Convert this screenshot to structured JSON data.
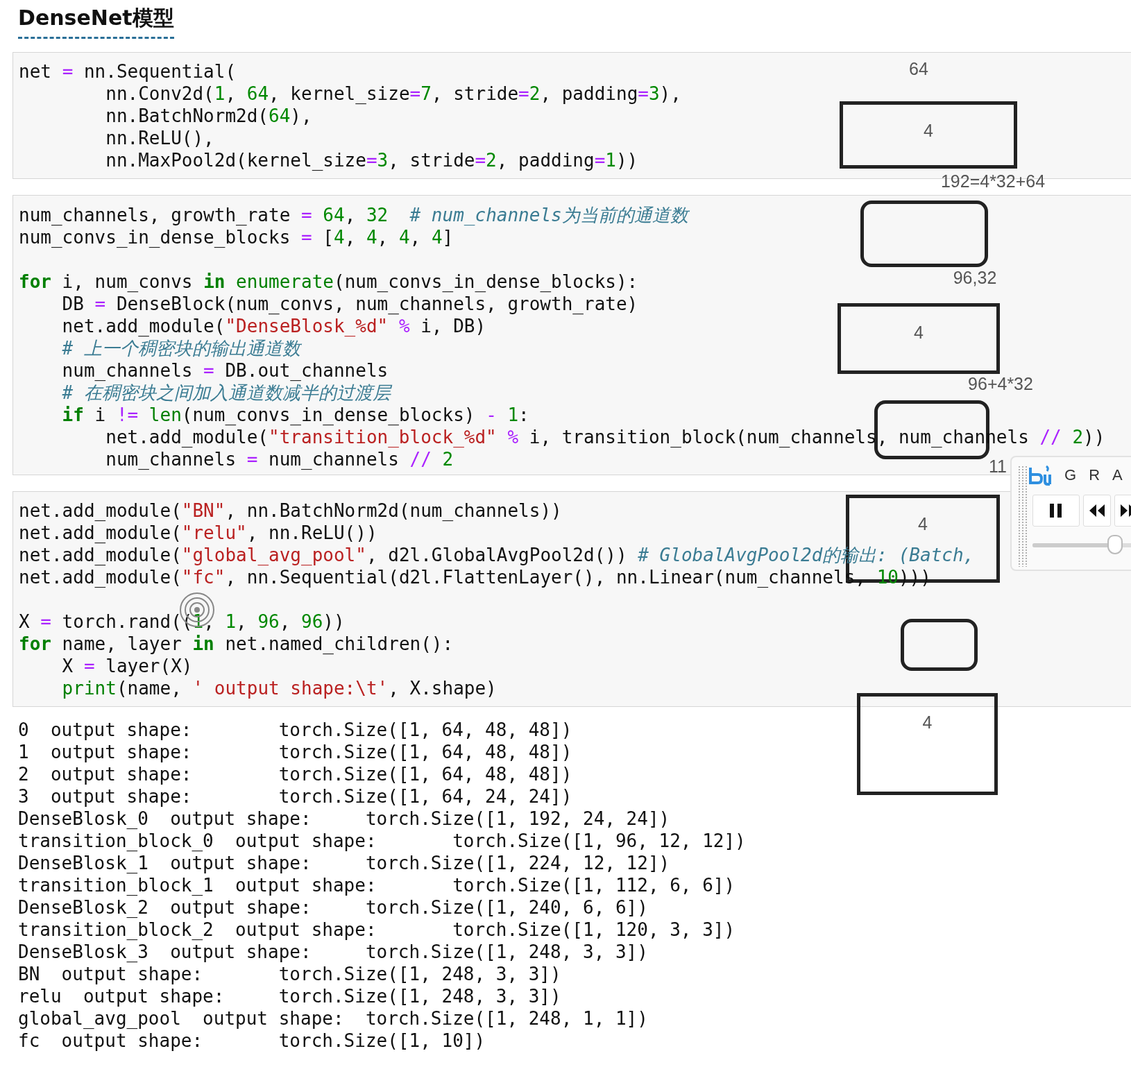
{
  "title": "DenseNet模型",
  "cells": [
    {
      "groups": [
        [
          [
            {
              "kind": "plain",
              "text": "net "
            },
            {
              "kind": "op",
              "text": "="
            },
            {
              "kind": "plain",
              "text": " nn.Sequential("
            }
          ],
          [
            {
              "kind": "plain",
              "text": "        nn.Conv2d("
            },
            {
              "kind": "num",
              "text": "1"
            },
            {
              "kind": "plain",
              "text": ", "
            },
            {
              "kind": "num",
              "text": "64"
            },
            {
              "kind": "plain",
              "text": ", kernel_size"
            },
            {
              "kind": "op",
              "text": "="
            },
            {
              "kind": "num",
              "text": "7"
            },
            {
              "kind": "plain",
              "text": ", stride"
            },
            {
              "kind": "op",
              "text": "="
            },
            {
              "kind": "num",
              "text": "2"
            },
            {
              "kind": "plain",
              "text": ", padding"
            },
            {
              "kind": "op",
              "text": "="
            },
            {
              "kind": "num",
              "text": "3"
            },
            {
              "kind": "plain",
              "text": "),"
            }
          ],
          [
            {
              "kind": "plain",
              "text": "        nn.BatchNorm2d("
            },
            {
              "kind": "num",
              "text": "64"
            },
            {
              "kind": "plain",
              "text": "),"
            }
          ],
          [
            {
              "kind": "plain",
              "text": "        nn.ReLU(),"
            }
          ],
          [
            {
              "kind": "plain",
              "text": "        nn.MaxPool2d(kernel_size"
            },
            {
              "kind": "op",
              "text": "="
            },
            {
              "kind": "num",
              "text": "3"
            },
            {
              "kind": "plain",
              "text": ", stride"
            },
            {
              "kind": "op",
              "text": "="
            },
            {
              "kind": "num",
              "text": "2"
            },
            {
              "kind": "plain",
              "text": ", padding"
            },
            {
              "kind": "op",
              "text": "="
            },
            {
              "kind": "num",
              "text": "1"
            },
            {
              "kind": "plain",
              "text": "))"
            }
          ]
        ]
      ]
    },
    {
      "groups": [
        [
          [
            {
              "kind": "plain",
              "text": "num_channels, growth_rate "
            },
            {
              "kind": "op",
              "text": "= "
            },
            {
              "kind": "num",
              "text": "64"
            },
            {
              "kind": "plain",
              "text": ", "
            },
            {
              "kind": "num",
              "text": "32"
            },
            {
              "kind": "comment",
              "text": "  # num_channels为当前的通道数"
            }
          ],
          [
            {
              "kind": "plain",
              "text": "num_convs_in_dense_blocks "
            },
            {
              "kind": "op",
              "text": "="
            },
            {
              "kind": "plain",
              "text": " ["
            },
            {
              "kind": "num",
              "text": "4"
            },
            {
              "kind": "plain",
              "text": ", "
            },
            {
              "kind": "num",
              "text": "4"
            },
            {
              "kind": "plain",
              "text": ", "
            },
            {
              "kind": "num",
              "text": "4"
            },
            {
              "kind": "plain",
              "text": ", "
            },
            {
              "kind": "num",
              "text": "4"
            },
            {
              "kind": "plain",
              "text": "]"
            }
          ]
        ],
        [
          [
            {
              "kind": "kw",
              "text": "for"
            },
            {
              "kind": "plain",
              "text": " i, num_convs "
            },
            {
              "kind": "kw",
              "text": "in"
            },
            {
              "kind": "builtin",
              "text": " enumerate"
            },
            {
              "kind": "plain",
              "text": "(num_convs_in_dense_blocks):"
            }
          ],
          [
            {
              "kind": "plain",
              "text": "    DB "
            },
            {
              "kind": "op",
              "text": "="
            },
            {
              "kind": "plain",
              "text": " DenseBlock(num_convs, num_channels, growth_rate)"
            }
          ],
          [
            {
              "kind": "plain",
              "text": "    net.add_module("
            },
            {
              "kind": "str",
              "text": "\"DenseBlosk_%d\""
            },
            {
              "kind": "op",
              "text": " %"
            },
            {
              "kind": "plain",
              "text": " i, DB)"
            }
          ],
          [
            {
              "kind": "comment",
              "text": "    # 上一个稠密块的输出通道数"
            }
          ],
          [
            {
              "kind": "plain",
              "text": "    num_channels "
            },
            {
              "kind": "op",
              "text": "="
            },
            {
              "kind": "plain",
              "text": " DB.out_channels"
            }
          ],
          [
            {
              "kind": "comment",
              "text": "    # 在稠密块之间加入通道数减半的过渡层"
            }
          ],
          [
            {
              "kind": "kw",
              "text": "    if"
            },
            {
              "kind": "plain",
              "text": " i "
            },
            {
              "kind": "op",
              "text": "!="
            },
            {
              "kind": "builtin",
              "text": " len"
            },
            {
              "kind": "plain",
              "text": "(num_convs_in_dense_blocks) "
            },
            {
              "kind": "op",
              "text": "-"
            },
            {
              "kind": "num",
              "text": " 1"
            },
            {
              "kind": "plain",
              "text": ":"
            }
          ],
          [
            {
              "kind": "plain",
              "text": "        net.add_module("
            },
            {
              "kind": "str",
              "text": "\"transition_block_%d\""
            },
            {
              "kind": "op",
              "text": " %"
            },
            {
              "kind": "plain",
              "text": " i, transition_block(num_channels, num_channels "
            },
            {
              "kind": "op",
              "text": "//"
            },
            {
              "kind": "num",
              "text": " 2"
            },
            {
              "kind": "plain",
              "text": "))"
            }
          ],
          [
            {
              "kind": "plain",
              "text": "        num_channels "
            },
            {
              "kind": "op",
              "text": "="
            },
            {
              "kind": "plain",
              "text": " num_channels "
            },
            {
              "kind": "op",
              "text": "//"
            },
            {
              "kind": "num",
              "text": " 2"
            }
          ]
        ]
      ]
    },
    {
      "groups": [
        [
          [
            {
              "kind": "plain",
              "text": "net.add_module("
            },
            {
              "kind": "str",
              "text": "\"BN\""
            },
            {
              "kind": "plain",
              "text": ", nn.BatchNorm2d(num_channels))"
            }
          ],
          [
            {
              "kind": "plain",
              "text": "net.add_module("
            },
            {
              "kind": "str",
              "text": "\"relu\""
            },
            {
              "kind": "plain",
              "text": ", nn.ReLU())"
            }
          ],
          [
            {
              "kind": "plain",
              "text": "net.add_module("
            },
            {
              "kind": "str",
              "text": "\"global_avg_pool\""
            },
            {
              "kind": "plain",
              "text": ", d2l.GlobalAvgPool2d())"
            },
            {
              "kind": "comment",
              "text": " # GlobalAvgPool2d的输出: (Batch,"
            }
          ],
          [
            {
              "kind": "plain",
              "text": "net.add_module("
            },
            {
              "kind": "str",
              "text": "\"fc\""
            },
            {
              "kind": "plain",
              "text": ", nn.Sequential(d2l.FlattenLayer(), nn.Linear(num_channels, "
            },
            {
              "kind": "num",
              "text": "10"
            },
            {
              "kind": "plain",
              "text": ")))"
            }
          ]
        ],
        [
          [
            {
              "kind": "plain",
              "text": "X "
            },
            {
              "kind": "op",
              "text": "="
            },
            {
              "kind": "plain",
              "text": " torch.rand(("
            },
            {
              "kind": "num",
              "text": "1"
            },
            {
              "kind": "plain",
              "text": ", "
            },
            {
              "kind": "num",
              "text": "1"
            },
            {
              "kind": "plain",
              "text": ", "
            },
            {
              "kind": "num",
              "text": "96"
            },
            {
              "kind": "plain",
              "text": ", "
            },
            {
              "kind": "num",
              "text": "96"
            },
            {
              "kind": "plain",
              "text": "))"
            }
          ],
          [
            {
              "kind": "kw",
              "text": "for"
            },
            {
              "kind": "plain",
              "text": " name, layer "
            },
            {
              "kind": "kw",
              "text": "in"
            },
            {
              "kind": "plain",
              "text": " net.named_children():"
            }
          ],
          [
            {
              "kind": "plain",
              "text": "    X "
            },
            {
              "kind": "op",
              "text": "="
            },
            {
              "kind": "plain",
              "text": " layer(X)"
            }
          ],
          [
            {
              "kind": "builtin",
              "text": "    print"
            },
            {
              "kind": "plain",
              "text": "(name, "
            },
            {
              "kind": "str",
              "text": "' output shape:\\t'"
            },
            {
              "kind": "plain",
              "text": ", X.shape)"
            }
          ]
        ]
      ]
    }
  ],
  "output": [
    "0  output shape:        torch.Size([1, 64, 48, 48])",
    "1  output shape:        torch.Size([1, 64, 48, 48])",
    "2  output shape:        torch.Size([1, 64, 48, 48])",
    "3  output shape:        torch.Size([1, 64, 24, 24])",
    "DenseBlosk_0  output shape:     torch.Size([1, 192, 24, 24])",
    "transition_block_0  output shape:       torch.Size([1, 96, 12, 12])",
    "DenseBlosk_1  output shape:     torch.Size([1, 224, 12, 12])",
    "transition_block_1  output shape:       torch.Size([1, 112, 6, 6])",
    "DenseBlosk_2  output shape:     torch.Size([1, 240, 6, 6])",
    "transition_block_2  output shape:       torch.Size([1, 120, 3, 3])",
    "DenseBlosk_3  output shape:     torch.Size([1, 248, 3, 3])",
    "BN  output shape:       torch.Size([1, 248, 3, 3])",
    "relu  output shape:     torch.Size([1, 248, 3, 3])",
    "global_avg_pool  output shape:  torch.Size([1, 248, 1, 1])",
    "fc  output shape:       torch.Size([1, 10])"
  ],
  "annotations": {
    "labels": [
      "64",
      "192=4*32+64",
      "96,32",
      "96+4*32",
      "11"
    ],
    "boxes": [
      {
        "kind": "square",
        "label": "4"
      },
      {
        "kind": "rounded"
      },
      {
        "kind": "square",
        "label": "4"
      },
      {
        "kind": "rounded"
      },
      {
        "kind": "square",
        "label": "4"
      },
      {
        "kind": "rounded"
      },
      {
        "kind": "square",
        "label": "4"
      }
    ]
  },
  "player_panel": {
    "letters": [
      "G",
      "R",
      "A"
    ],
    "buttons": [
      {
        "kind": "pause"
      },
      {
        "kind": "rewind"
      },
      {
        "kind": "forward"
      }
    ],
    "slider": {
      "level": 0.79
    }
  }
}
